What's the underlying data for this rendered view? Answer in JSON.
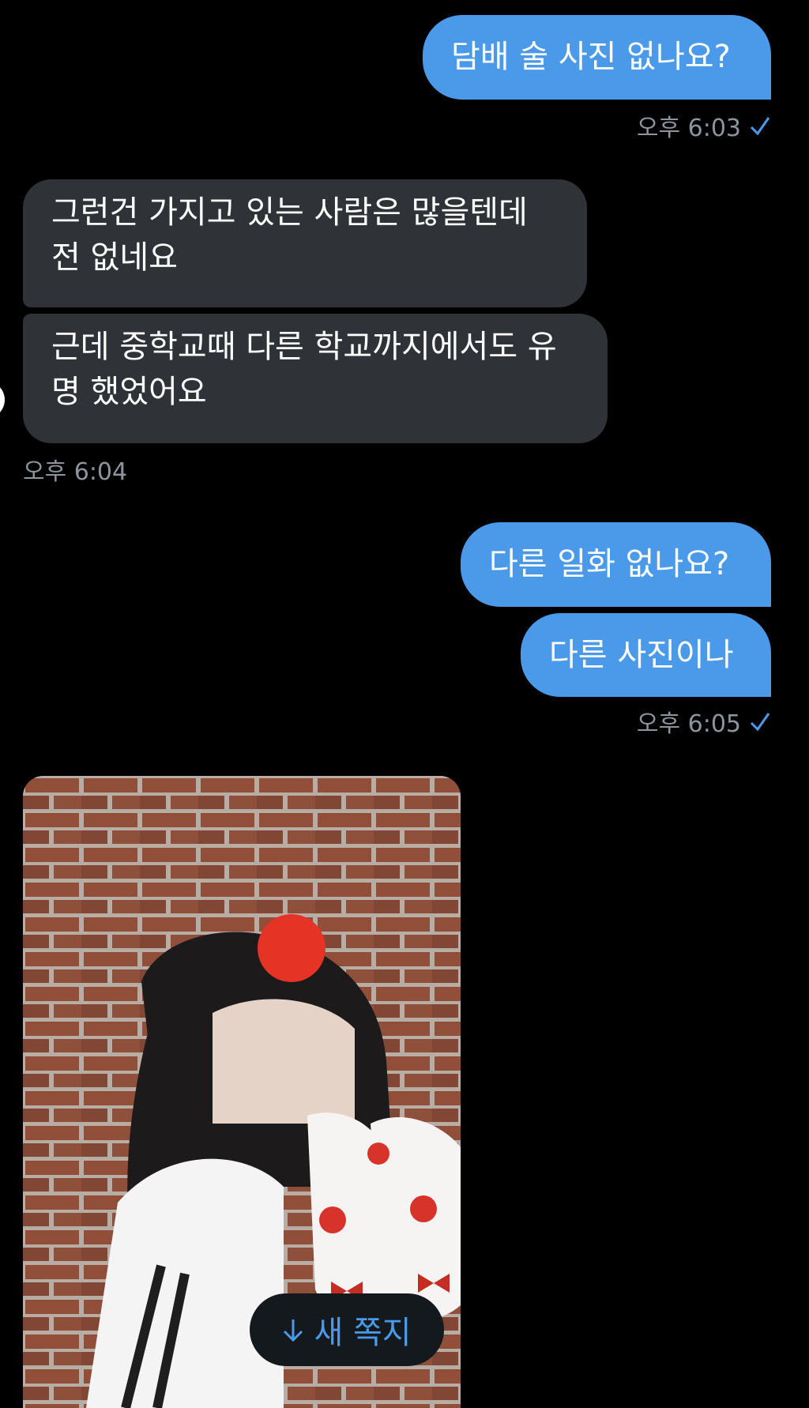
{
  "messages": [
    {
      "text": "담배 술 사진 없나요?"
    },
    {
      "text": "오후 6:03"
    },
    {
      "line1": "그런건 가지고 있는 사람은 많을텐데",
      "line2": "전 없네요"
    },
    {
      "line1": "근데 중학교때 다른 학교까지에서도 유",
      "line2": "명 했었어요"
    },
    {
      "text": "오후 6:04"
    },
    {
      "text": "다른 일화 없나요?"
    },
    {
      "text": "다른 사진이나"
    },
    {
      "text": "오후 6:05"
    }
  ],
  "new_message_button": {
    "label": "새 쪽지",
    "icon": "arrow-down-icon"
  },
  "colors": {
    "outgoing": "#4a9ae9",
    "incoming": "#2f3338",
    "background": "#000000",
    "accent": "#4a9ae9"
  }
}
